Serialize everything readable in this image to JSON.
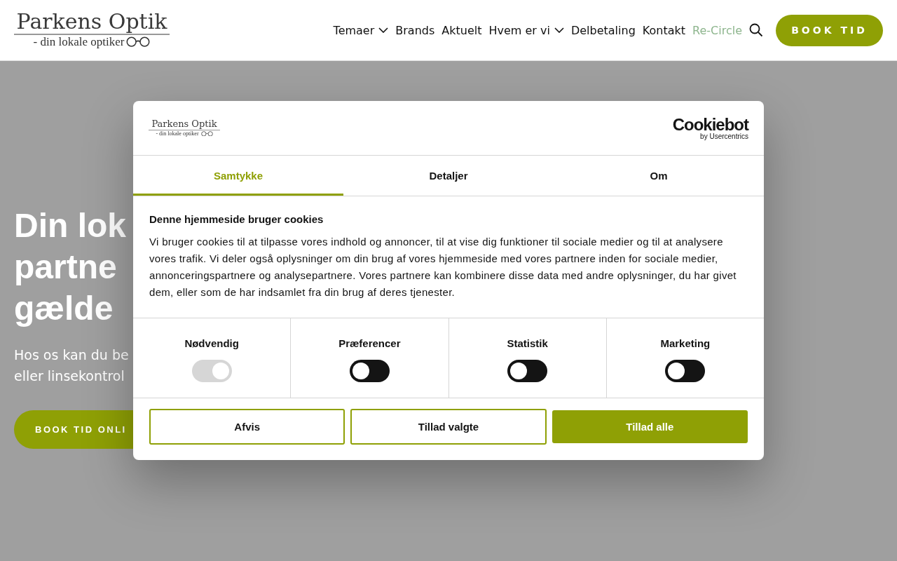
{
  "header": {
    "logo": {
      "name": "Parkens Optik",
      "tagline": "- din lokale optiker"
    },
    "nav": [
      {
        "label": "Temaer",
        "dropdown": true,
        "highlight": false
      },
      {
        "label": "Brands",
        "dropdown": false,
        "highlight": false
      },
      {
        "label": "Aktuelt",
        "dropdown": false,
        "highlight": false
      },
      {
        "label": "Hvem er vi",
        "dropdown": true,
        "highlight": false
      },
      {
        "label": "Delbetaling",
        "dropdown": false,
        "highlight": false
      },
      {
        "label": "Kontakt",
        "dropdown": false,
        "highlight": false
      },
      {
        "label": "Re-Circle",
        "dropdown": false,
        "highlight": true
      }
    ],
    "cta": "BOOK TID"
  },
  "hero": {
    "heading_lines": [
      "Din lok",
      "partne",
      "gælde"
    ],
    "text_lines": [
      "Hos os kan du be",
      "eller linsekontrol"
    ],
    "button": "BOOK TID ONLI"
  },
  "cookie_dialog": {
    "logo": {
      "name": "Parkens Optik",
      "tagline": "- din lokale optiker"
    },
    "brand": {
      "name": "Cookiebot",
      "sub": "by Usercentrics"
    },
    "tabs": [
      {
        "label": "Samtykke",
        "selected": true
      },
      {
        "label": "Detaljer",
        "selected": false
      },
      {
        "label": "Om",
        "selected": false
      }
    ],
    "title": "Denne hjemmeside bruger cookies",
    "body": "Vi bruger cookies til at tilpasse vores indhold og annoncer, til at vise dig funktioner til sociale medier og til at analysere vores trafik. Vi deler også oplysninger om din brug af vores hjemmeside med vores partnere inden for sociale medier, annonceringspartnere og analysepartnere. Vores partnere kan kombinere disse data med andre oplysninger, du har givet dem, eller som de har indsamlet fra din brug af deres tjenester.",
    "categories": [
      {
        "label": "Nødvendig",
        "checked": true,
        "disabled": true
      },
      {
        "label": "Præferencer",
        "checked": false,
        "disabled": false
      },
      {
        "label": "Statistik",
        "checked": false,
        "disabled": false
      },
      {
        "label": "Marketing",
        "checked": false,
        "disabled": false
      }
    ],
    "buttons": [
      {
        "label": "Afvis",
        "kind": "outline"
      },
      {
        "label": "Tillad valgte",
        "kind": "outline"
      },
      {
        "label": "Tillad alle",
        "kind": "filled"
      }
    ]
  }
}
